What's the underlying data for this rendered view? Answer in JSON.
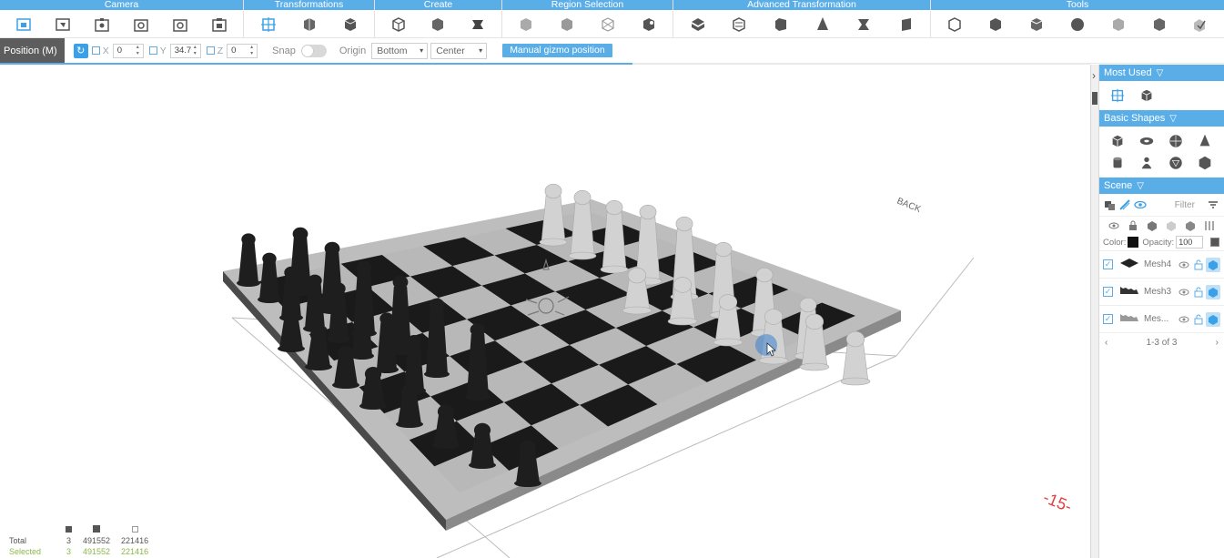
{
  "ribbon": {
    "groups": [
      {
        "label": "Camera",
        "icons": [
          "camera-front-icon",
          "camera-top-icon",
          "camera-left-icon",
          "camera-right-icon",
          "camera-back-icon",
          "camera-bottom-icon"
        ]
      },
      {
        "label": "Transformations",
        "icons": [
          "move-icon",
          "rotate-icon",
          "scale-icon"
        ]
      },
      {
        "label": "Create",
        "icons": [
          "cube-icon",
          "cylinder-icon",
          "extrude-icon"
        ]
      },
      {
        "label": "Region Selection",
        "icons": [
          "select-box-icon",
          "select-brush-icon",
          "select-lasso-icon",
          "select-invert-icon"
        ]
      },
      {
        "label": "Advanced Transformation",
        "icons": [
          "bend-icon",
          "twist-icon",
          "taper-icon",
          "cone-icon",
          "warp-icon",
          "shear-icon"
        ]
      },
      {
        "label": "Tools",
        "icons": [
          "hollow-icon",
          "cut-icon",
          "merge-icon",
          "smooth-icon",
          "repair-icon",
          "measure-icon",
          "export-icon"
        ]
      }
    ]
  },
  "options": {
    "mode_label": "Position (M)",
    "x_label": "X",
    "x_value": "0",
    "y_label": "Y",
    "y_value": "34.7",
    "z_label": "Z",
    "z_value": "0",
    "snap_label": "Snap",
    "origin_label": "Origin",
    "origin_vertical": "Bottom",
    "origin_horizontal": "Center",
    "gizmo_button": "Manual gizmo position",
    "progress": 0.58
  },
  "viewport": {
    "back_label": "BACK",
    "axis_label": "-15-",
    "stats": {
      "total_label": "Total",
      "total": [
        "3",
        "491552",
        "221416"
      ],
      "selected_label": "Selected",
      "selected": [
        "3",
        "491552",
        "221416"
      ]
    }
  },
  "panel": {
    "most_used": {
      "title": "Most Used",
      "icons": [
        "move-icon",
        "cube-icon"
      ]
    },
    "basic_shapes": {
      "title": "Basic Shapes",
      "icons": [
        "cube-icon",
        "torus-icon",
        "sphere-icon",
        "cone-icon",
        "cylinder-icon",
        "figure-icon",
        "dodecahedron-icon",
        "icosahedron-icon"
      ]
    },
    "scene": {
      "title": "Scene",
      "filter": "Filter",
      "color_label": "Color:",
      "color": "#111111",
      "opacity_label": "Opacity:",
      "opacity_value": "100",
      "meshes": [
        {
          "name": "Mesh4"
        },
        {
          "name": "Mesh3"
        },
        {
          "name": "Mes..."
        }
      ],
      "pager": "1-3 of 3"
    }
  },
  "colors": {
    "accent": "#5aaee8",
    "board_dark": "#1a1a1a",
    "board_light": "#b8b8b8"
  }
}
